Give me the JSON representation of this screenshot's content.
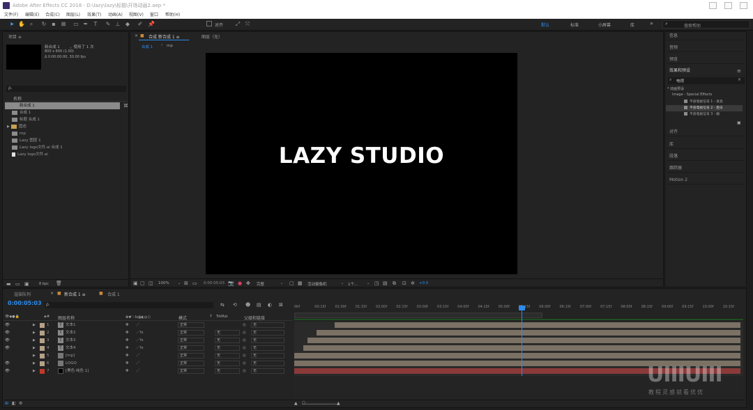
{
  "window": {
    "title": "Adobe After Effects CC 2018 - D:\\lazy\\lazy\\标题\\开场动画2.aep *"
  },
  "menu": [
    "文件(F)",
    "编辑(E)",
    "合成(C)",
    "图层(L)",
    "效果(T)",
    "动画(A)",
    "视图(V)",
    "窗口",
    "帮助(H)"
  ],
  "toolbar": {
    "snap_label": "对齐",
    "workspaces": [
      "默认",
      "标准",
      "小屏幕",
      "库"
    ],
    "search_placeholder": "搜索帮助"
  },
  "project": {
    "title": "项目 ≡",
    "comp_name": "新合成 1",
    "used": "，使用了 1 次",
    "size": "800 x 600 (1.00)",
    "duration": "Δ 0:00:00:00, 30.00 fps",
    "search_placeholder": "ρ.",
    "column_name": "名称",
    "items": [
      {
        "name": "新合成 1",
        "selected": true
      },
      {
        "name": "合成 1"
      },
      {
        "name": "标题 合成 1"
      },
      {
        "name": "固态",
        "folder": true
      },
      {
        "name": "mp"
      },
      {
        "name": "Lazy 图层 1"
      },
      {
        "name": "Lazy logo文件.ai 合成 1"
      },
      {
        "name": "Lazy logo文件.ai"
      }
    ],
    "bottom_label": "8 bpc"
  },
  "viewer": {
    "tabs": [
      "合成 新合成 1 ≡",
      "图层（无）"
    ],
    "breadcrumb_active": "合成 1",
    "breadcrumb_other": "mp",
    "canvas_text": "LAZY STUDIO",
    "zoom": "100%",
    "timecode": "0:00:05:03",
    "quality": "完整",
    "camera": "活动摄像机",
    "views": "1个...",
    "exposure": "+0.0"
  },
  "right_panel": {
    "items_top": [
      "信息",
      "音频",
      "预览"
    ],
    "effects_title": "效果和预设",
    "effects_search": "电视",
    "tree_root": "* 动画预设",
    "tree_folder": "Image - Special Effects",
    "tree_items": [
      "不良电视信号 1 - 发亮",
      "不良电视信号 2 - 变白",
      "不良电视信号 3 - 弱"
    ],
    "items_bottom": [
      "对齐",
      "库",
      "段落",
      "跟踪器",
      "Motion 2"
    ]
  },
  "timeline": {
    "tabs": [
      "渲染队列",
      "新合成 1 ≡",
      "合成 1"
    ],
    "timecode": "0:00:05:03",
    "search_placeholder": "ρ.",
    "columns": {
      "name": "图层名称",
      "mode": "模式",
      "t": "T",
      "trkmat": "TrkMat",
      "parent": "父级和链接"
    },
    "ruler": [
      "00f",
      "00:15f",
      "01:00f",
      "01:15f",
      "02:00f",
      "02:15f",
      "03:00f",
      "03:15f",
      "04:00f",
      "04:15f",
      "05:00f",
      "05:15f",
      "06:00f",
      "06:15f",
      "07:00f",
      "07:15f",
      "08:00f",
      "08:15f",
      "09:00f",
      "09:15f",
      "10:00f",
      "10:15f"
    ],
    "layers": [
      {
        "num": "1",
        "name": "文本1",
        "mode": "正常",
        "trkmat": "",
        "parent": "无",
        "color": "#b5a088",
        "bar_start": 0.09,
        "bar_end": 1.0
      },
      {
        "num": "2",
        "name": "文本2",
        "mode": "正常",
        "trkmat": "无",
        "parent": "无",
        "color": "#b5a088",
        "bar_start": 0.05,
        "bar_end": 1.0
      },
      {
        "num": "3",
        "name": "文本3",
        "mode": "正常",
        "trkmat": "无",
        "parent": "无",
        "color": "#b5a088",
        "bar_start": 0.03,
        "bar_end": 1.0
      },
      {
        "num": "4",
        "name": "文本4",
        "mode": "正常",
        "trkmat": "无",
        "parent": "无",
        "color": "#b5a088",
        "bar_start": 0.02,
        "bar_end": 1.0
      },
      {
        "num": "5",
        "name": "[mp]",
        "mode": "正常",
        "trkmat": "无",
        "parent": "无",
        "color": "#b5a088",
        "bar_start": 0.0,
        "bar_end": 1.0
      },
      {
        "num": "6",
        "name": "LOGO",
        "mode": "正常",
        "trkmat": "无",
        "parent": "无",
        "color": "#b5a088",
        "bar_start": 0.0,
        "bar_end": 1.0
      },
      {
        "num": "7",
        "name": "[黑色 纯色 1]",
        "mode": "正常",
        "trkmat": "无",
        "parent": "无",
        "color": "#c0392b",
        "bar_start": 0.0,
        "bar_end": 1.0
      }
    ]
  },
  "watermark": {
    "logo": "UIIIUIII",
    "tagline": "教程灵感就看优优"
  },
  "colors": {
    "bg": "#1d1d1d",
    "panel": "#232323",
    "accent": "#2d8ceb",
    "canvas": "#000000",
    "red_layer": "#8b3a3a"
  }
}
